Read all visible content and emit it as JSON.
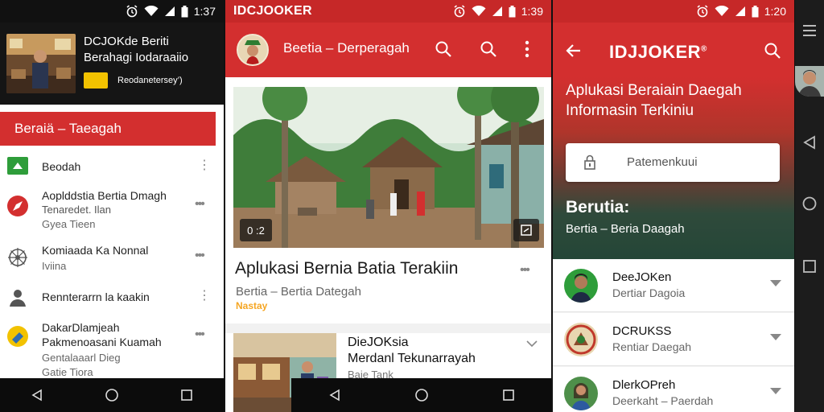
{
  "status": {
    "time_left": "1:37",
    "time_mid": "1:39",
    "time_right": "1:20"
  },
  "panel1": {
    "header_title": "DCJOKde Beriti Berahagi Iodaraaiio",
    "header_subtitle": "Reodanetersey’)",
    "tab_label": "Beraiä – Taeagah",
    "items": [
      {
        "line1": "Beodah",
        "line2": "",
        "line3": ""
      },
      {
        "line1": "Aoplddstia Bertia Dmagh",
        "line2": "Tenaredet. Ilan",
        "line3": "Gyea Tieen"
      },
      {
        "line1": "Komiaada Ka Nonnal",
        "line2": "Iviina",
        "line3": ""
      },
      {
        "line1": "Rennterarrn la kaakin",
        "line2": "",
        "line3": ""
      },
      {
        "line1": "DakarDlamjeah",
        "line2": "Pakmenoasani Kuamah",
        "line3": "Gentalaaarl Dieg"
      },
      {
        "line1": "Gatie Tiora",
        "line2": "",
        "line3": ""
      }
    ]
  },
  "panel2": {
    "app_name": "IDCJOOKER",
    "toolbar_title": "Beetia – Derperagah",
    "image_badge_left": "0 :2",
    "headline": "Aplukasi Bernia Batia Terakiin",
    "meta": "Bertia – Bertia Dategah",
    "tag": "Nastay",
    "row": {
      "title1": "DieJOKsia",
      "title2": "Merdanl Tekunarrayah",
      "sub": "Baie Tank"
    }
  },
  "panel3": {
    "brand": "IDJJOKER",
    "hero_title": "Aplukasi Beraiain Daegah Informasin Terkiniu",
    "search_placeholder": "Patemenkuui",
    "section_title": "Berutia:",
    "section_sub": "Bertia – Beria Daagah",
    "items": [
      {
        "name": "DeeJOKen",
        "sub": "Dertiar Dagoia"
      },
      {
        "name": "DCRUKSS",
        "sub": "Rentiar Daegah"
      },
      {
        "name": "DlerkOPreh",
        "sub": "Deerkaht – Paerdah"
      }
    ]
  },
  "colors": {
    "brand_red": "#d32f2f",
    "status_red": "#c62828",
    "accent_yellow": "#f2c200",
    "tag_orange": "#f5a623",
    "hero_green": "#244637"
  },
  "icons": [
    "alarm-icon",
    "wifi-icon",
    "signal-icon",
    "battery-icon",
    "search-icon",
    "more-vert-icon",
    "back-arrow-icon",
    "home-icon",
    "recents-icon",
    "menu-icon",
    "lock-icon",
    "chevron-down-icon"
  ]
}
